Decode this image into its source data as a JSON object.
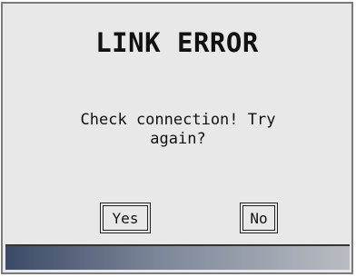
{
  "dialog": {
    "title": "LINK ERROR",
    "message": "Check connection! Try again?",
    "buttons": {
      "yes_label": "Yes",
      "no_label": "No"
    }
  },
  "colors": {
    "background": "#e8e8e8",
    "border": "#7a7a7a",
    "text": "#111111",
    "statusbar_start": "#3c4a66",
    "statusbar_end": "#b9bcc2"
  }
}
